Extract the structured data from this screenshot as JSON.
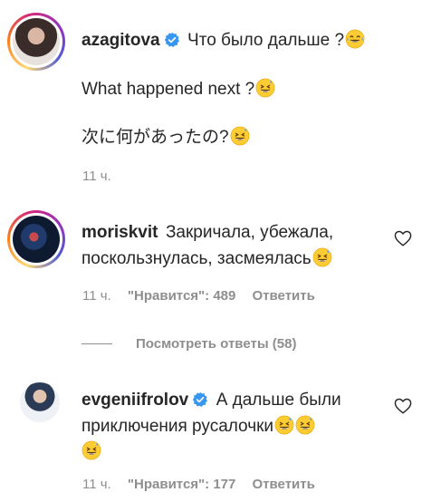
{
  "comments": [
    {
      "username": "azagitova",
      "lines": [
        "Что было дальше ?",
        "What happened next ?",
        "次に何があったの?"
      ],
      "time": "11 ч."
    },
    {
      "username": "moriskvit",
      "lines": [
        "Закричала, убежала,",
        "поскользнулась, засмеялась"
      ],
      "time": "11 ч.",
      "likes": "\"Нравится\": 489",
      "reply": "Ответить"
    },
    {
      "username": "evgeniifrolov",
      "lines": [
        "А дальше были",
        "приключения русалочки"
      ],
      "time": "11 ч.",
      "likes": "\"Нравится\": 177",
      "reply": "Ответить"
    }
  ],
  "view_replies": "Посмотреть ответы (58)",
  "colors": {
    "verified": "#3897f0",
    "meta": "#8e8e8e",
    "text": "#262626"
  },
  "icons": [
    "verified-badge-icon",
    "rolling-laughing-emoji",
    "grinning-sweat-emoji",
    "heart-outline-icon"
  ]
}
